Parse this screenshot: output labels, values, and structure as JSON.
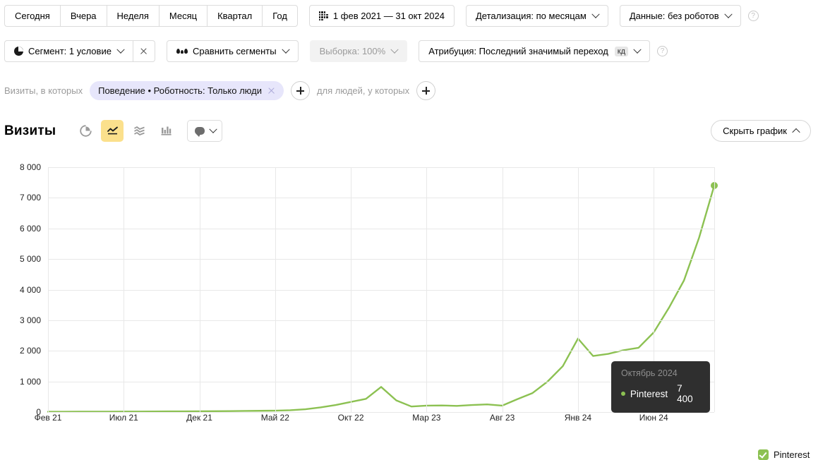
{
  "toolbar": {
    "period_buttons": [
      "Сегодня",
      "Вчера",
      "Неделя",
      "Месяц",
      "Квартал",
      "Год"
    ],
    "date_range": "1 фев 2021 — 31 окт 2024",
    "date_range_icon": "calendar-icon",
    "detail": "Детализация: по месяцам",
    "data_source": "Данные: без роботов",
    "help_icon": "help-icon"
  },
  "toolbar2": {
    "segment": "Сегмент: 1 условие",
    "segment_icon": "pie-chart-icon",
    "segment_clear_icon": "close-icon",
    "compare": "Сравнить сегменты",
    "compare_icon": "compare-drops-icon",
    "sample": "Выборка: 100%",
    "attribution": "Атрибуция: Последний значимый переход",
    "attribution_badge": "кд",
    "help_icon": "help-icon"
  },
  "filters": {
    "prefix_label": "Визиты, в которых",
    "chip_label": "Поведение • Роботность: Только люди",
    "chip_close_icon": "close-icon",
    "add_visit_condition_icon": "plus-icon",
    "middle_label": "для людей, у которых",
    "add_people_condition_icon": "plus-icon"
  },
  "metric_header": {
    "title": "Визиты",
    "viz_buttons": [
      {
        "name": "pie-chart-view-icon",
        "active": false
      },
      {
        "name": "line-chart-view-icon",
        "active": true
      },
      {
        "name": "area-chart-view-icon",
        "active": false
      },
      {
        "name": "bar-chart-view-icon",
        "active": false
      }
    ],
    "notes_label": "",
    "notes_icon": "comment-icon",
    "hide_chart_label": "Скрыть график",
    "hide_chart_icon": "chevron-up-icon"
  },
  "tooltip": {
    "title": "Октябрь 2024",
    "series": "Pinterest",
    "value": "7 400"
  },
  "legend": [
    {
      "label": "Pinterest",
      "color": "#8cc152",
      "checked": true
    }
  ],
  "colors": {
    "line": "#8cc152",
    "accent_yellow": "#fbe08c",
    "chip_violet": "#e7e6fb",
    "tooltip_bg": "#2f2f2f",
    "grid": "#e8e8e8"
  },
  "chart_data": {
    "type": "line",
    "title": "Визиты",
    "xlabel": "",
    "ylabel": "",
    "ylim": [
      0,
      8000
    ],
    "ytick_values": [
      0,
      1000,
      2000,
      3000,
      4000,
      5000,
      6000,
      7000,
      8000
    ],
    "ytick_labels": [
      "0",
      "1 000",
      "2 000",
      "3 000",
      "4 000",
      "5 000",
      "6 000",
      "7 000",
      "8 000"
    ],
    "xtick_labels": [
      "Фев 21",
      "Июл 21",
      "Дек 21",
      "Май 22",
      "Окт 22",
      "Мар 23",
      "Авг 23",
      "Янв 24",
      "Июн 24"
    ],
    "grid": true,
    "legend_position": "right",
    "x": [
      "Фев 21",
      "Мар 21",
      "Апр 21",
      "Май 21",
      "Июн 21",
      "Июл 21",
      "Авг 21",
      "Сен 21",
      "Окт 21",
      "Ноя 21",
      "Дек 21",
      "Янв 22",
      "Фев 22",
      "Мар 22",
      "Апр 22",
      "Май 22",
      "Июн 22",
      "Июл 22",
      "Авг 22",
      "Сен 22",
      "Окт 22",
      "Ноя 22",
      "Дек 22",
      "Янв 23",
      "Фев 23",
      "Мар 23",
      "Апр 23",
      "Май 23",
      "Июн 23",
      "Июл 23",
      "Авг 23",
      "Сен 23",
      "Окт 23",
      "Ноя 23",
      "Дек 23",
      "Янв 24",
      "Фев 24",
      "Мар 24",
      "Апр 24",
      "Май 24",
      "Июн 24",
      "Июл 24",
      "Авг 24",
      "Сен 24",
      "Окт 24"
    ],
    "series": [
      {
        "name": "Pinterest",
        "color": "#8cc152",
        "values": [
          10,
          10,
          12,
          12,
          14,
          15,
          16,
          18,
          20,
          22,
          25,
          28,
          30,
          35,
          40,
          45,
          60,
          90,
          150,
          230,
          330,
          430,
          820,
          380,
          180,
          210,
          215,
          200,
          230,
          250,
          210,
          420,
          620,
          1000,
          1500,
          2400,
          1830,
          1900,
          2020,
          2100,
          2600,
          3400,
          4300,
          5700,
          7400
        ]
      }
    ],
    "highlight_point": {
      "x": "Окт 24",
      "y": 7400
    }
  }
}
